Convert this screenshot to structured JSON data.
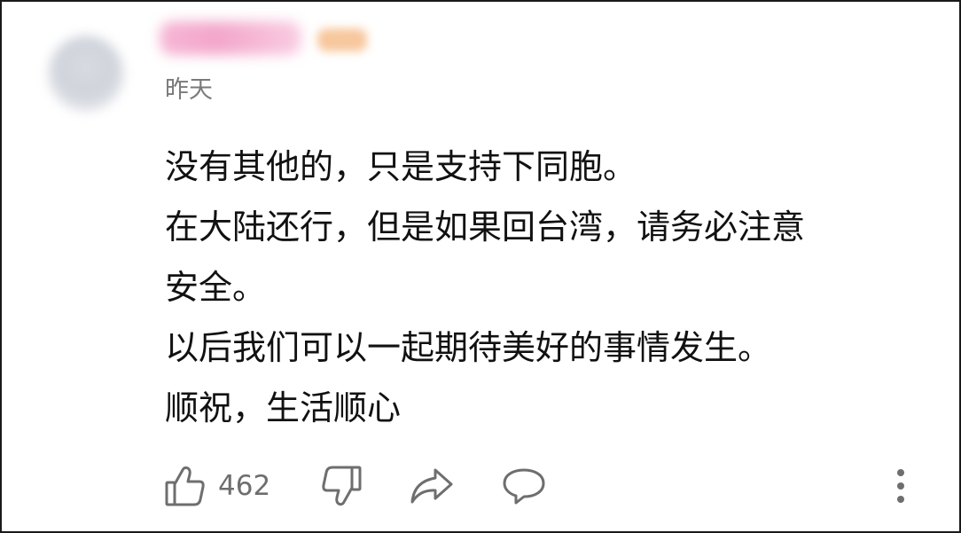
{
  "comment": {
    "timestamp": "昨天",
    "lines": [
      "没有其他的，只是支持下同胞。",
      "在大陆还行，但是如果回台湾，请务必注意",
      "安全。",
      "以后我们可以一起期待美好的事情发生。",
      "顺祝，生活顺心"
    ]
  },
  "actions": {
    "like_count": "462"
  },
  "icons": {
    "like": "thumbs-up-icon",
    "dislike": "thumbs-down-icon",
    "share": "share-arrow-icon",
    "reply": "speech-bubble-icon",
    "more": "vertical-dots-icon"
  },
  "colors": {
    "text": "#111111",
    "muted": "#7a7a7a",
    "icon": "#6e6e6e"
  }
}
